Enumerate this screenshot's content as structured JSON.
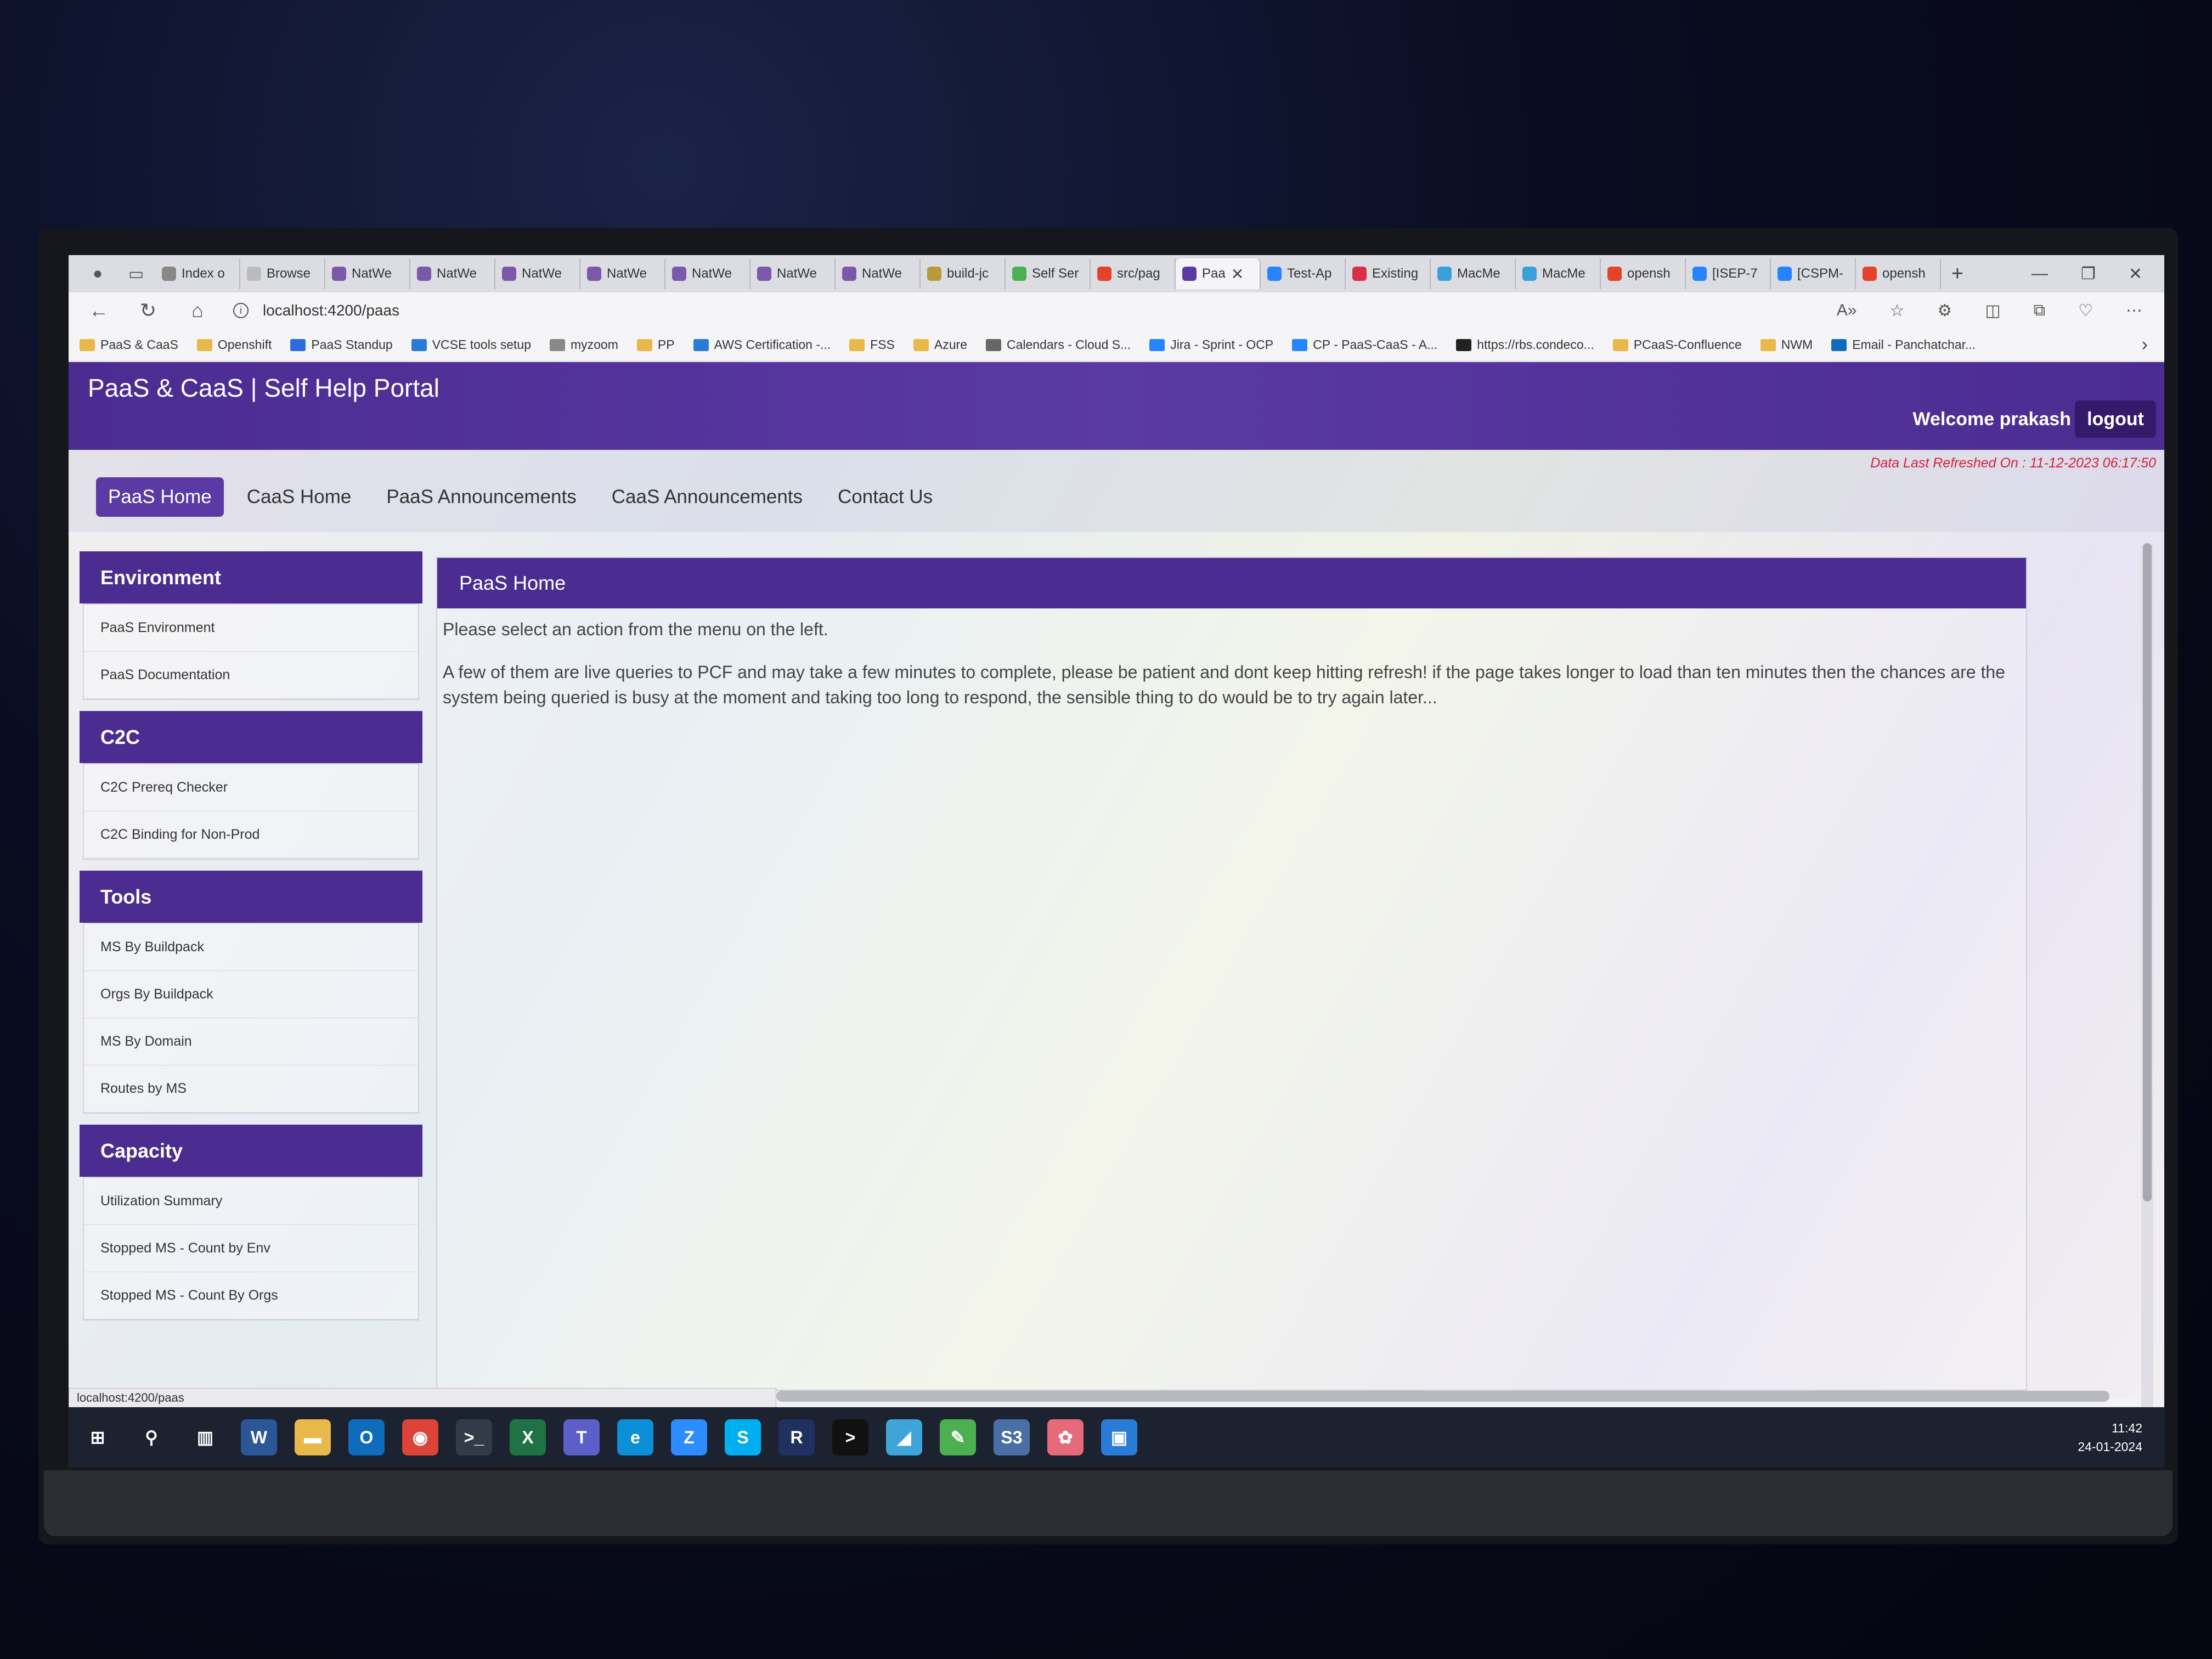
{
  "browser": {
    "tabs": [
      {
        "label": "Index o",
        "icon": "page-icon",
        "color": "#888888"
      },
      {
        "label": "Browse",
        "icon": "w-icon",
        "color": "#bbbbbb"
      },
      {
        "label": "NatWe",
        "icon": "nat-icon",
        "color": "#7a5aa8"
      },
      {
        "label": "NatWe",
        "icon": "nat-icon",
        "color": "#7a5aa8"
      },
      {
        "label": "NatWe",
        "icon": "nat-icon",
        "color": "#7a5aa8"
      },
      {
        "label": "NatWe",
        "icon": "nat-icon",
        "color": "#7a5aa8"
      },
      {
        "label": "NatWe",
        "icon": "nat-icon",
        "color": "#7a5aa8"
      },
      {
        "label": "NatWe",
        "icon": "nat-icon",
        "color": "#7a5aa8"
      },
      {
        "label": "NatWe",
        "icon": "nat-icon",
        "color": "#7a5aa8"
      },
      {
        "label": "build-jc",
        "icon": "bucket-icon",
        "color": "#b89a3a"
      },
      {
        "label": "Self Ser",
        "icon": "circle-icon",
        "color": "#4caf50"
      },
      {
        "label": "src/pag",
        "icon": "gitlab-icon",
        "color": "#e2432a"
      },
      {
        "label": "Paa",
        "icon": "recycle-icon",
        "color": "#5b3aa5",
        "active": true
      },
      {
        "label": "Test-Ap",
        "icon": "jira-icon",
        "color": "#2684ff"
      },
      {
        "label": "Existing",
        "icon": "mail-icon",
        "color": "#d9304a"
      },
      {
        "label": "MacMe",
        "icon": "x-icon",
        "color": "#3aa0d8"
      },
      {
        "label": "MacMe",
        "icon": "x-icon",
        "color": "#3aa0d8"
      },
      {
        "label": "opensh",
        "icon": "gitlab-icon",
        "color": "#e2432a"
      },
      {
        "label": "[ISEP-7",
        "icon": "jira-icon",
        "color": "#2684ff"
      },
      {
        "label": "[CSPM-",
        "icon": "jira-icon",
        "color": "#2684ff"
      },
      {
        "label": "opensh",
        "icon": "gitlab-icon",
        "color": "#e2432a"
      }
    ],
    "url": "localhost:4200/paas",
    "bookmarks": [
      {
        "label": "PaaS & CaaS",
        "type": "folder"
      },
      {
        "label": "Openshift",
        "type": "folder"
      },
      {
        "label": "PaaS Standup",
        "type": "zoom",
        "color": "#2d6cdf"
      },
      {
        "label": "VCSE tools setup",
        "type": "x",
        "color": "#2a7bd5"
      },
      {
        "label": "myzoom",
        "type": "page",
        "color": "#888888"
      },
      {
        "label": "PP",
        "type": "folder"
      },
      {
        "label": "AWS Certification -...",
        "type": "x",
        "color": "#2a7bd5"
      },
      {
        "label": "FSS",
        "type": "folder"
      },
      {
        "label": "Azure",
        "type": "folder"
      },
      {
        "label": "Calendars - Cloud S...",
        "type": "calendar",
        "color": "#666666"
      },
      {
        "label": "Jira - Sprint - OCP",
        "type": "jira",
        "color": "#2684ff"
      },
      {
        "label": "CP - PaaS-CaaS - A...",
        "type": "jira",
        "color": "#2684ff"
      },
      {
        "label": "https://rbs.condeco...",
        "type": "x",
        "color": "#222222"
      },
      {
        "label": "PCaaS-Confluence",
        "type": "folder"
      },
      {
        "label": "NWM",
        "type": "folder"
      },
      {
        "label": "Email - Panchatchar...",
        "type": "outlook",
        "color": "#0f6cbd"
      }
    ],
    "status_url": "localhost:4200/paas"
  },
  "header": {
    "title": "PaaS & CaaS | Self Help Portal",
    "welcome": "Welcome prakash",
    "logout": "logout",
    "refreshed": "Data Last Refreshed On : 11-12-2023 06:17:50"
  },
  "nav": [
    {
      "label": "PaaS Home",
      "active": true
    },
    {
      "label": "CaaS Home"
    },
    {
      "label": "PaaS Announcements"
    },
    {
      "label": "CaaS Announcements"
    },
    {
      "label": "Contact Us"
    }
  ],
  "sidebar": [
    {
      "title": "Environment",
      "items": [
        "PaaS Environment",
        "PaaS Documentation"
      ]
    },
    {
      "title": "C2C",
      "items": [
        "C2C Prereq Checker",
        "C2C Binding for Non-Prod"
      ]
    },
    {
      "title": "Tools",
      "items": [
        "MS By Buildpack",
        "Orgs By Buildpack",
        "MS By Domain",
        "Routes by MS"
      ]
    },
    {
      "title": "Capacity",
      "items": [
        "Utilization Summary",
        "Stopped MS - Count by Env",
        "Stopped MS - Count By Orgs"
      ]
    }
  ],
  "main": {
    "title": "PaaS Home",
    "p1": "Please select an action from the menu on the left.",
    "p2": "A few of them are live queries to PCF and may take a few minutes to complete, please be patient and dont keep hitting refresh! if the page takes longer to load than ten minutes then the chances are the system being queried is busy at the moment and taking too long to respond, the sensible thing to do would be to try again later..."
  },
  "taskbar": {
    "apps": [
      {
        "name": "start-icon",
        "glyph": "⊞",
        "color": "#1c2230"
      },
      {
        "name": "search-icon",
        "glyph": "⚲",
        "color": "#1c2230"
      },
      {
        "name": "taskview-icon",
        "glyph": "▥",
        "color": "#1c2230"
      },
      {
        "name": "word-icon",
        "glyph": "W",
        "color": "#2b5797"
      },
      {
        "name": "explorer-icon",
        "glyph": "▬",
        "color": "#e8b84a"
      },
      {
        "name": "outlook-icon",
        "glyph": "O",
        "color": "#0f6cbd"
      },
      {
        "name": "chrome-icon",
        "glyph": "◉",
        "color": "#db4437"
      },
      {
        "name": "terminal-icon",
        "glyph": ">_",
        "color": "#333a48"
      },
      {
        "name": "excel-icon",
        "glyph": "X",
        "color": "#1f7244"
      },
      {
        "name": "teams-icon",
        "glyph": "T",
        "color": "#5b5fc7"
      },
      {
        "name": "edge-icon",
        "glyph": "e",
        "color": "#0c8fd6"
      },
      {
        "name": "z-app-icon",
        "glyph": "Z",
        "color": "#2d8cff"
      },
      {
        "name": "skype-icon",
        "glyph": "S",
        "color": "#00aff0"
      },
      {
        "name": "r-app-icon",
        "glyph": "R",
        "color": "#203060"
      },
      {
        "name": "cmd-icon",
        "glyph": ">",
        "color": "#111111"
      },
      {
        "name": "azure-icon",
        "glyph": "◢",
        "color": "#3fa4d8"
      },
      {
        "name": "notepad-icon",
        "glyph": "✎",
        "color": "#4caf50"
      },
      {
        "name": "s3-icon",
        "glyph": "S3",
        "color": "#4a6fa5"
      },
      {
        "name": "brain-icon",
        "glyph": "✿",
        "color": "#e66a7a"
      },
      {
        "name": "window-icon",
        "glyph": "▣",
        "color": "#2a7bd5"
      }
    ],
    "time": "11:42",
    "date": "24-01-2024"
  }
}
